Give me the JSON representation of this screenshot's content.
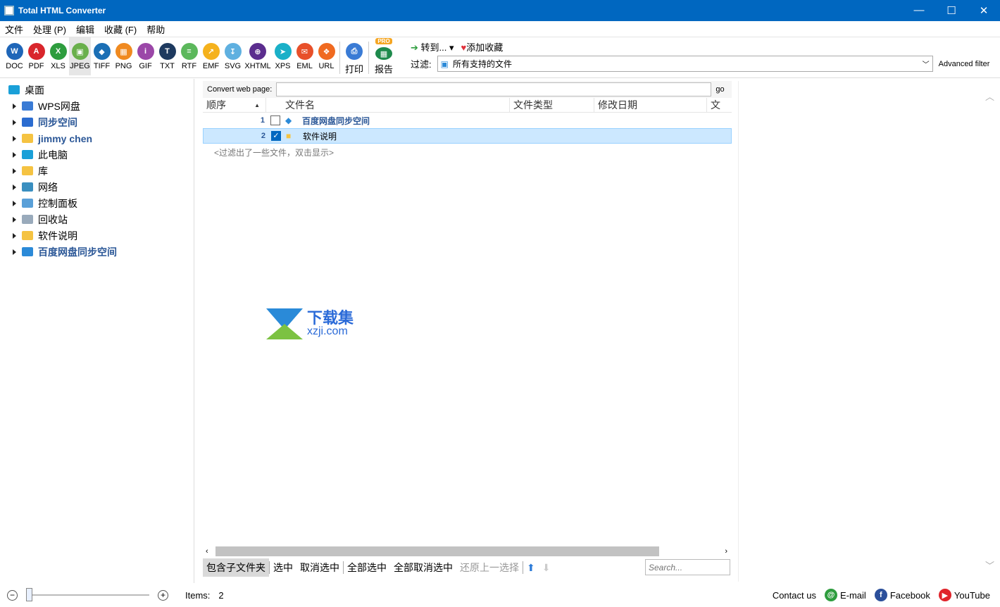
{
  "window": {
    "title": "Total HTML Converter"
  },
  "menu": [
    "文件",
    "处理 (P)",
    "编辑",
    "收藏 (F)",
    "帮助"
  ],
  "formats": [
    {
      "label": "DOC",
      "color": "#1f66b8",
      "glyph": "W"
    },
    {
      "label": "PDF",
      "color": "#d9262c",
      "glyph": "A"
    },
    {
      "label": "XLS",
      "color": "#2e9d3e",
      "glyph": "X"
    },
    {
      "label": "JPEG",
      "color": "#6ab04c",
      "glyph": "▣"
    },
    {
      "label": "TIFF",
      "color": "#1b6fb5",
      "glyph": "◆"
    },
    {
      "label": "PNG",
      "color": "#f08a20",
      "glyph": "▦"
    },
    {
      "label": "GIF",
      "color": "#9b47a8",
      "glyph": "i"
    },
    {
      "label": "TXT",
      "color": "#1e3a5f",
      "glyph": "T"
    },
    {
      "label": "RTF",
      "color": "#5cb85c",
      "glyph": "≡"
    },
    {
      "label": "EMF",
      "color": "#f5b21d",
      "glyph": "↗"
    },
    {
      "label": "SVG",
      "color": "#5fb0e0",
      "glyph": "↧"
    },
    {
      "label": "XHTML",
      "color": "#5b2d8e",
      "glyph": "⊕"
    },
    {
      "label": "XPS",
      "color": "#1ab0c8",
      "glyph": "➤"
    },
    {
      "label": "EML",
      "color": "#e8502a",
      "glyph": "✉"
    },
    {
      "label": "URL",
      "color": "#f06a20",
      "glyph": "❖"
    }
  ],
  "active_format": "JPEG",
  "toolbar": {
    "print": "打印",
    "report": "报告",
    "pro_badge": "PRO",
    "goto": "转到...",
    "add_fav": "添加收藏",
    "filter_label": "过滤:",
    "filter_value": "所有支持的文件",
    "advanced_filter": "Advanced filter"
  },
  "tree": [
    {
      "label": "桌面",
      "root": true,
      "color": "#1aa0d8"
    },
    {
      "label": "WPS网盘",
      "color": "#3a7bd5"
    },
    {
      "label": "同步空间",
      "color": "#2b6cd0",
      "blue": true
    },
    {
      "label": "jimmy chen",
      "color": "#f5c342",
      "blue": true
    },
    {
      "label": "此电脑",
      "color": "#1aa0d8"
    },
    {
      "label": "库",
      "color": "#f5c342"
    },
    {
      "label": "网络",
      "color": "#3a8fc0"
    },
    {
      "label": "控制面板",
      "color": "#5aa0d8"
    },
    {
      "label": "回收站",
      "color": "#9ab"
    },
    {
      "label": "软件说明",
      "color": "#f5c342"
    },
    {
      "label": "百度网盘同步空间",
      "color": "#2b8ad8",
      "blue": true
    }
  ],
  "web": {
    "label": "Convert web page:",
    "value": "",
    "go": "go"
  },
  "columns": [
    "顺序",
    "文件名",
    "文件类型",
    "修改日期",
    "文"
  ],
  "files": [
    {
      "index": "1",
      "name": "百度网盘同步空间",
      "checked": false,
      "blue": true
    },
    {
      "index": "2",
      "name": "软件说明",
      "checked": true,
      "blue": false
    }
  ],
  "hint": "<过滤出了一些文件，双击显示>",
  "bottom": {
    "include_sub": "包含子文件夹",
    "select": "选中",
    "deselect": "取消选中",
    "select_all": "全部选中",
    "deselect_all": "全部取消选中",
    "restore": "还原上一选择",
    "search_placeholder": "Search..."
  },
  "status": {
    "items_label": "Items:",
    "items_count": "2",
    "contact": "Contact us",
    "email": "E-mail",
    "facebook": "Facebook",
    "youtube": "YouTube"
  },
  "watermark": {
    "cn": "下载集",
    "en": "xzji.com"
  }
}
